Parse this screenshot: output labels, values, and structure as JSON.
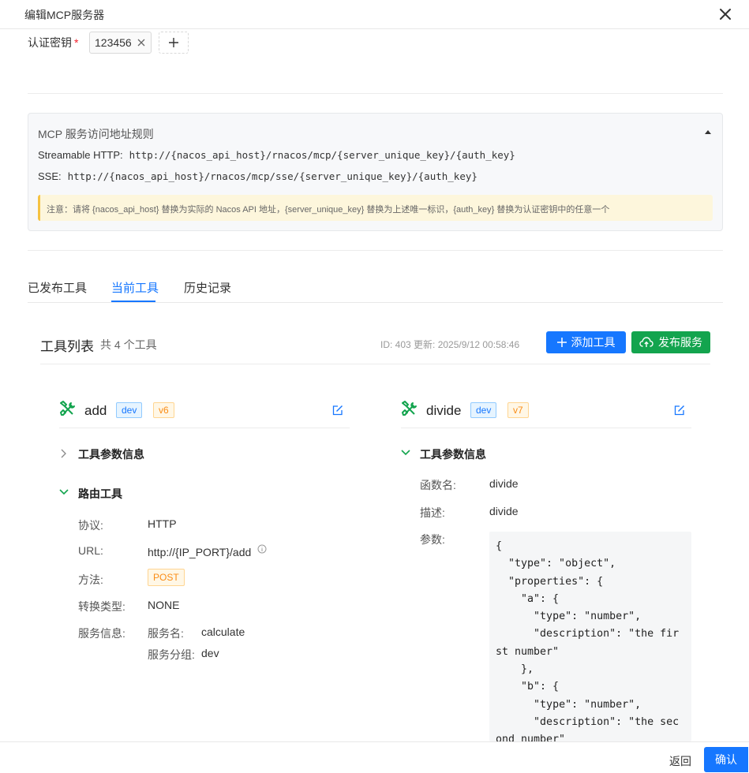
{
  "dialog": {
    "title": "编辑MCP服务器"
  },
  "auth": {
    "label": "认证密钥",
    "required_mark": "*",
    "keys": [
      "123456"
    ]
  },
  "rules": {
    "title": "MCP 服务访问地址规则",
    "streamable_label": "Streamable HTTP:",
    "streamable_value": "http://{nacos_api_host}/rnacos/mcp/{server_unique_key}/{auth_key}",
    "sse_label": "SSE:",
    "sse_value": "http://{nacos_api_host}/rnacos/mcp/sse/{server_unique_key}/{auth_key}",
    "note": "注意：请将 {nacos_api_host} 替换为实际的 Nacos API 地址，{server_unique_key} 替换为上述唯一标识，{auth_key} 替换为认证密钥中的任意一个"
  },
  "tabs": [
    {
      "label": "已发布工具"
    },
    {
      "label": "当前工具"
    },
    {
      "label": "历史记录"
    }
  ],
  "toolbar": {
    "title": "工具列表",
    "count": "共 4 个工具",
    "meta": "ID: 403   更新: 2025/9/12 00:58:46",
    "add_button": "添加工具",
    "publish_button": "发布服务"
  },
  "tools": [
    {
      "name": "add",
      "env": "dev",
      "version": "v6",
      "params_title": "工具参数信息",
      "route_title": "路由工具",
      "route": {
        "protocol_label": "协议:",
        "protocol": "HTTP",
        "url_label": "URL:",
        "url": "http://{IP_PORT}/add",
        "method_label": "方法:",
        "method": "POST",
        "convert_label": "转换类型:",
        "convert": "NONE",
        "service_label": "服务信息:",
        "service_name_label": "服务名:",
        "service_name": "calculate",
        "service_group_label": "服务分组:",
        "service_group": "dev"
      }
    },
    {
      "name": "divide",
      "env": "dev",
      "version": "v7",
      "params_title": "工具参数信息",
      "func_label": "函数名:",
      "func": "divide",
      "desc_label": "描述:",
      "desc": "divide",
      "params_label": "参数:",
      "params_code": "{\n  \"type\": \"object\",\n  \"properties\": {\n    \"a\": {\n      \"type\": \"number\",\n      \"description\": \"the first number\"\n    },\n    \"b\": {\n      \"type\": \"number\",\n      \"description\": \"the second number\""
    }
  ],
  "footer": {
    "back": "返回",
    "confirm": "确认"
  },
  "colors": {
    "primary": "#1677ff",
    "success": "#13a44e",
    "warning": "#fa8c16"
  }
}
